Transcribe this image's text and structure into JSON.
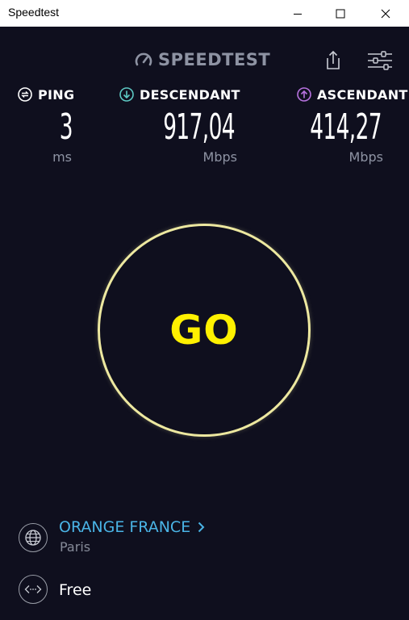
{
  "window": {
    "title": "Speedtest"
  },
  "header": {
    "logo_text": "SPEEDTEST",
    "share_icon": "share-icon",
    "settings_icon": "settings-sliders-icon"
  },
  "metrics": {
    "ping": {
      "label": "PING",
      "value": "3",
      "unit": "ms",
      "icon": "ping-icon",
      "color": "#ffffff"
    },
    "download": {
      "label": "DESCENDANT",
      "value": "917,04",
      "unit": "Mbps",
      "icon": "download-arrow-icon",
      "color": "#5ec9c4"
    },
    "upload": {
      "label": "ASCENDANT",
      "value": "414,27",
      "unit": "Mbps",
      "icon": "upload-arrow-icon",
      "color": "#b873e0"
    }
  },
  "go_button": {
    "label": "GO",
    "ring_color": "#ede8a0",
    "text_color": "#fff100"
  },
  "provider": {
    "isp_name": "ORANGE FRANCE",
    "isp_location": "Paris",
    "isp_color": "#4ab4e6",
    "server_name": "Free"
  },
  "colors": {
    "background": "#0f0f1e",
    "muted_text": "#8e93a3"
  }
}
